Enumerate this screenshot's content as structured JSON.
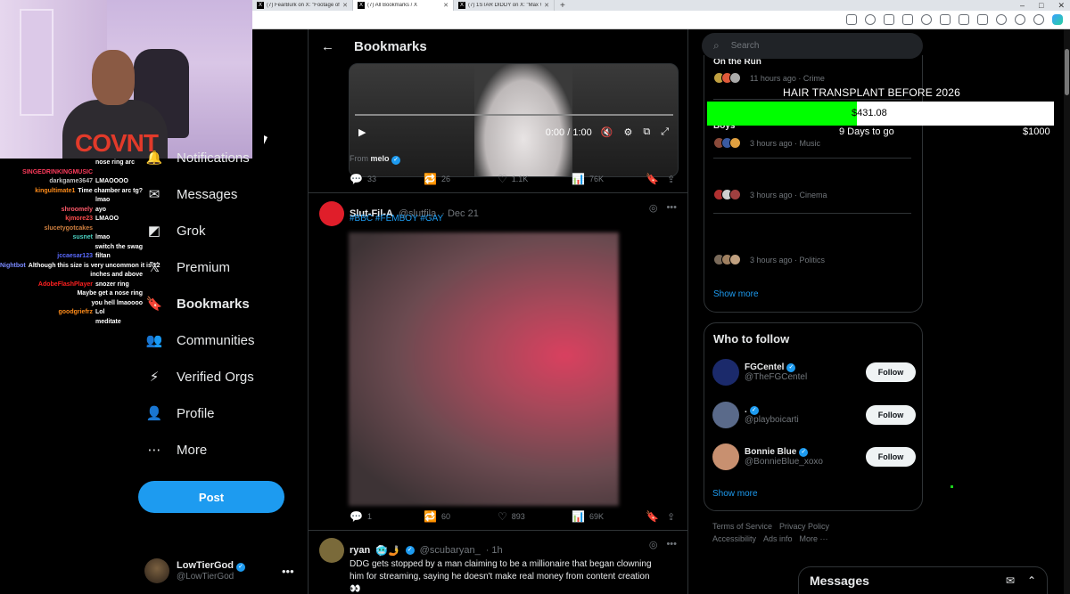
{
  "browser": {
    "tabs": [
      {
        "title": "(7) FearBurk on X: \"Footage of a",
        "active": false
      },
      {
        "title": "(7) All Bookmarks / X",
        "active": true
      },
      {
        "title": "(7) 1STAR DIDDY on X: \"Max Wh",
        "active": false
      }
    ],
    "new_tab": "+",
    "window_controls": [
      "–",
      "□",
      "✕"
    ]
  },
  "webcam": {
    "shirt_text": "COVNT"
  },
  "chat": [
    {
      "user": "",
      "msg": "nose ring arc",
      "color": "#ffffff"
    },
    {
      "user": "SINGEDRINKINGMUSIC",
      "msg": "",
      "color": "#ff3b5c"
    },
    {
      "user": "darkgame3647",
      "msg": "LMAOOOO",
      "color": "#c0c0c0"
    },
    {
      "user": "kingultimate1",
      "msg": "Time chamber arc tg?",
      "color": "#ff8c1a"
    },
    {
      "user": "",
      "msg": "lmao",
      "color": "#ffffff"
    },
    {
      "user": "shroomely",
      "msg": "ayo",
      "color": "#ff5a6a"
    },
    {
      "user": "kjmore23",
      "msg": "LMAOO",
      "color": "#ff4d4d"
    },
    {
      "user": "slucetygotcakes",
      "msg": "",
      "color": "#d08040"
    },
    {
      "user": "susnet",
      "msg": "lmao",
      "color": "#4ad0c0"
    },
    {
      "user": "",
      "msg": "switch the swag",
      "color": "#ffffff"
    },
    {
      "user": "jccaesar123",
      "msg": "filtan",
      "color": "#5a6aff"
    },
    {
      "user": "Nightbot",
      "msg": "Although this size is very uncommon it is 12",
      "color": "#7a8aff"
    },
    {
      "user": "",
      "msg": "inches and above",
      "color": "#ffffff"
    },
    {
      "user": "AdobeFlashPlayer",
      "msg": "snozer ring",
      "color": "#ff2020"
    },
    {
      "user": "",
      "msg": "Maybe get a nose ring",
      "color": "#ffffff"
    },
    {
      "user": "",
      "msg": "you hell lmaoooo",
      "color": "#ffffff"
    },
    {
      "user": "goodgriefrz",
      "msg": "Lol",
      "color": "#ff8c1a"
    },
    {
      "user": "",
      "msg": "meditate",
      "color": "#ffffff"
    }
  ],
  "nav": {
    "items": [
      {
        "label": "Notifications",
        "icon": "bell-icon",
        "glyph": "🔔"
      },
      {
        "label": "Messages",
        "icon": "envelope-icon",
        "glyph": "✉"
      },
      {
        "label": "Grok",
        "icon": "grok-icon",
        "glyph": "◩"
      },
      {
        "label": "Premium",
        "icon": "x-logo-icon",
        "glyph": "𝕏"
      },
      {
        "label": "Bookmarks",
        "icon": "bookmark-icon",
        "glyph": "🔖"
      },
      {
        "label": "Communities",
        "icon": "communities-icon",
        "glyph": "👥"
      },
      {
        "label": "Verified Orgs",
        "icon": "lightning-icon",
        "glyph": "⚡"
      },
      {
        "label": "Profile",
        "icon": "person-icon",
        "glyph": "👤"
      },
      {
        "label": "More",
        "icon": "more-circle-icon",
        "glyph": "⋯"
      }
    ],
    "post_label": "Post",
    "account": {
      "name": "LowTierGod",
      "handle": "@LowTierGod",
      "more": "•••"
    }
  },
  "header": {
    "back": "←",
    "title": "Bookmarks"
  },
  "video_tweet": {
    "time": "0:00 / 1:00",
    "from_prefix": "From",
    "from_user": "melo",
    "stats": {
      "replies": "33",
      "reposts": "26",
      "likes": "1.1K",
      "views": "76K"
    }
  },
  "tweet2": {
    "name": "Slut-Fil-A",
    "handle": "@slutfila",
    "date": "· Dec 21",
    "hashtags": "#BBC #FEMBOY #GAY",
    "stats": {
      "replies": "1",
      "reposts": "60",
      "likes": "893",
      "views": "69K"
    }
  },
  "tweet3": {
    "name": "ryan",
    "emojis": "🥶🤳",
    "handle": "@scubaryan_",
    "date": "· 1h",
    "text": "DDG gets stopped by a man claiming to be a millionaire that began clowning him for streaming, saying he doesn't make real money from content creation 👀"
  },
  "search": {
    "placeholder": "Search"
  },
  "trends": [
    {
      "title": "On the Run",
      "meta": "11 hours ago · Crime"
    },
    {
      "title": "Boys",
      "meta": "3 hours ago · Music"
    },
    {
      "title": "",
      "meta": "3 hours ago · Cinema"
    },
    {
      "title": "",
      "meta": "3 hours ago · Politics"
    }
  ],
  "trends_show_more": "Show more",
  "who_to_follow": {
    "title": "Who to follow",
    "accounts": [
      {
        "name": "FGCentel",
        "handle": "@TheFGCentel",
        "follow": "Follow",
        "color": "#1b2a6b"
      },
      {
        "name": ".",
        "handle": "@playboicarti",
        "follow": "Follow",
        "color": "#5a6a8a"
      },
      {
        "name": "Bonnie Blue",
        "handle": "@BonnieBlue_xoxo",
        "follow": "Follow",
        "color": "#c89070"
      }
    ],
    "show_more": "Show more"
  },
  "footer": {
    "links": [
      "Terms of Service",
      "Privacy Policy",
      "Accessibility",
      "Ads info",
      "More ···"
    ]
  },
  "messages_drawer": {
    "title": "Messages"
  },
  "goal": {
    "title": "HAIR TRANSPLANT BEFORE 2026",
    "amount": "$431.08",
    "days": "9 Days to go",
    "target": "$1000",
    "progress": 0.431,
    "fill_color": "#00ff00"
  }
}
